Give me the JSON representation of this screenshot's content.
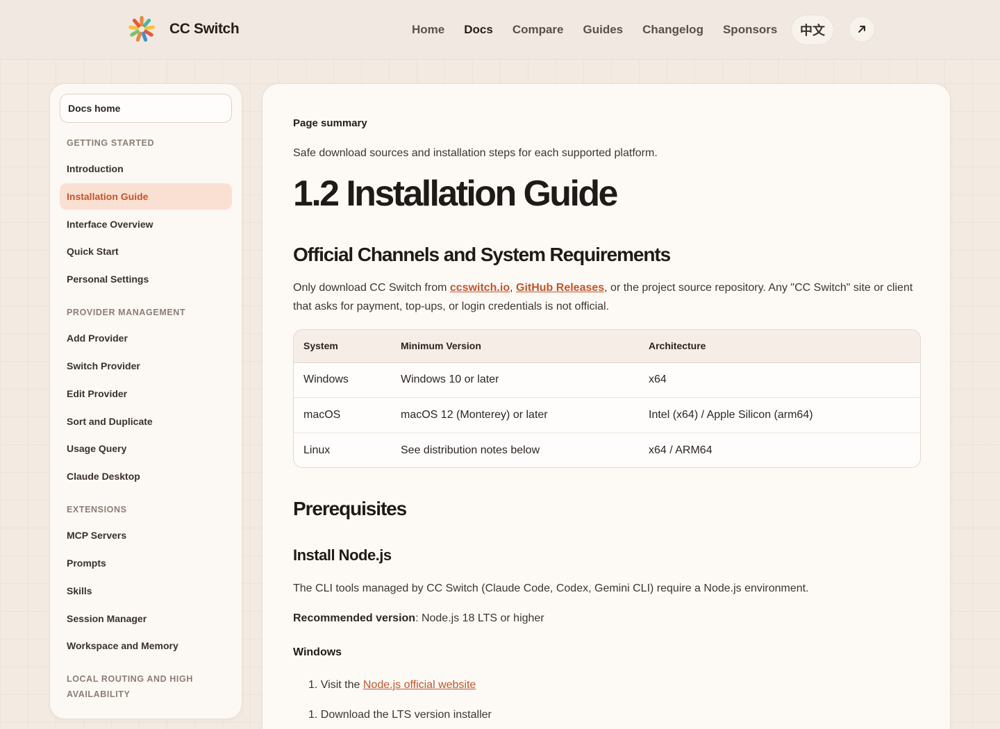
{
  "header": {
    "brand": "CC Switch",
    "nav": [
      "Home",
      "Docs",
      "Compare",
      "Guides",
      "Changelog",
      "Sponsors"
    ],
    "active_nav": "Docs",
    "lang_label": "中文",
    "external_icon": "arrow-up-right-icon"
  },
  "sidebar": {
    "docs_home": "Docs home",
    "sections": [
      {
        "title": "GETTING STARTED",
        "items": [
          "Introduction",
          "Installation Guide",
          "Interface Overview",
          "Quick Start",
          "Personal Settings"
        ]
      },
      {
        "title": "PROVIDER MANAGEMENT",
        "items": [
          "Add Provider",
          "Switch Provider",
          "Edit Provider",
          "Sort and Duplicate",
          "Usage Query",
          "Claude Desktop"
        ]
      },
      {
        "title": "EXTENSIONS",
        "items": [
          "MCP Servers",
          "Prompts",
          "Skills",
          "Session Manager",
          "Workspace and Memory"
        ]
      },
      {
        "title": "LOCAL ROUTING AND HIGH AVAILABILITY",
        "items": []
      }
    ],
    "active_item": "Installation Guide"
  },
  "main": {
    "summary_label": "Page summary",
    "summary_text": "Safe download sources and installation steps for each supported platform.",
    "title": "1.2 Installation Guide",
    "section1_title": "Official Channels and System Requirements",
    "para1": {
      "pre": "Only download CC Switch from ",
      "link1": "ccswitch.io",
      "sep": ", ",
      "link2": "GitHub Releases",
      "post": ", or the project source repository. Any \"CC Switch\" site or client that asks for payment, top-ups, or login credentials is not official."
    },
    "table": {
      "headers": [
        "System",
        "Minimum Version",
        "Architecture"
      ],
      "rows": [
        [
          "Windows",
          "Windows 10 or later",
          "x64"
        ],
        [
          "macOS",
          "macOS 12 (Monterey) or later",
          "Intel (x64) / Apple Silicon (arm64)"
        ],
        [
          "Linux",
          "See distribution notes below",
          "x64 / ARM64"
        ]
      ]
    },
    "section2_title": "Prerequisites",
    "subsection_title": "Install Node.js",
    "para2": "The CLI tools managed by CC Switch (Claude Code, Codex, Gemini CLI) require a Node.js environment.",
    "rec_label": "Recommended version",
    "rec_value": ": Node.js 18 LTS or higher",
    "windows_title": "Windows",
    "step1_num": "1.",
    "step1_pre": "Visit the ",
    "step1_link": "Node.js official website",
    "step2_num": "1.",
    "step2_text": "Download the LTS version installer"
  }
}
